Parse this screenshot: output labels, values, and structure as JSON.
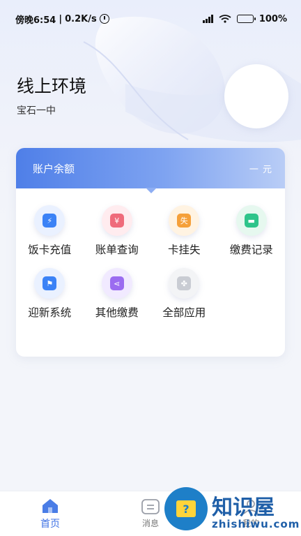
{
  "status_bar": {
    "time": "傍晚6:54",
    "network_speed": "0.2K/s",
    "battery": "100%",
    "icons": [
      "alarm-icon",
      "signal-icon",
      "wifi-icon",
      "battery-icon"
    ]
  },
  "header": {
    "title": "线上环境",
    "subtitle": "宝石一中"
  },
  "balance": {
    "label": "账户余额",
    "value": "一 元"
  },
  "apps": [
    {
      "label": "饭卡充值",
      "icon": "card-recharge-icon",
      "color": "#3b82f6",
      "glyph": "⚡"
    },
    {
      "label": "账单查询",
      "icon": "bill-query-icon",
      "color": "#ef6b7b",
      "glyph": "¥"
    },
    {
      "label": "卡挂失",
      "icon": "card-lost-icon",
      "color": "#f5a03a",
      "glyph": "失"
    },
    {
      "label": "缴费记录",
      "icon": "payment-record-icon",
      "color": "#2ec48a",
      "glyph": "▬"
    },
    {
      "label": "迎新系统",
      "icon": "flag-icon",
      "color": "#3b82f6",
      "glyph": "⚑"
    },
    {
      "label": "其他缴费",
      "icon": "share-icon",
      "color": "#9b6cf0",
      "glyph": "⋖"
    },
    {
      "label": "全部应用",
      "icon": "grid-icon",
      "color": "#c9ccd3",
      "glyph": "✤"
    }
  ],
  "nav": {
    "home": "首页",
    "messages": "消息",
    "mine": "我的"
  },
  "watermark": {
    "badge_glyph": "?",
    "title": "知识屋",
    "url": "zhishiwu.com"
  },
  "colors": {
    "accent": "#3f72e4",
    "balance_bar_start": "#4f7fe8",
    "background": "#f3f5fa"
  }
}
